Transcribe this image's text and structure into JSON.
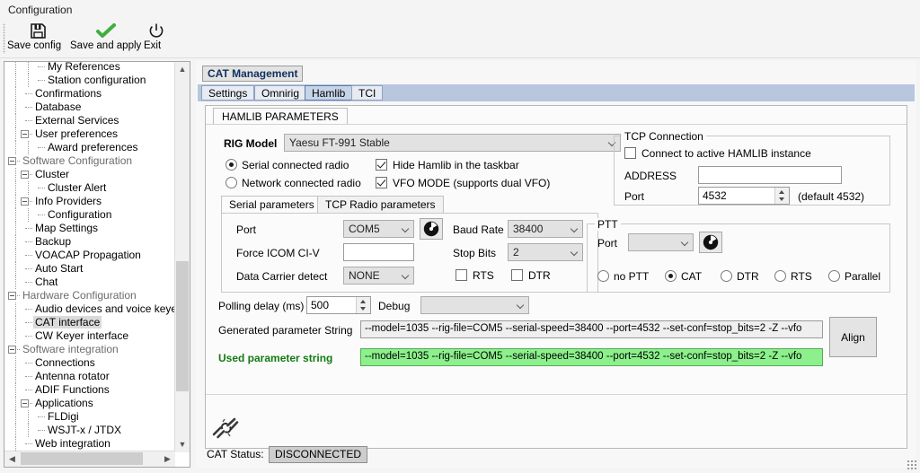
{
  "window": {
    "title": "Configuration"
  },
  "toolbar": {
    "buttons": [
      {
        "label": "Save config",
        "icon": "floppy-disk-icon"
      },
      {
        "label": "Save and apply",
        "icon": "green-check-icon"
      },
      {
        "label": "Exit",
        "icon": "power-icon"
      }
    ]
  },
  "tree": {
    "items": [
      {
        "label": "My References",
        "indent": 3,
        "type": "leaf",
        "state": "normal"
      },
      {
        "label": "Station configuration",
        "indent": 3,
        "type": "last",
        "state": "normal"
      },
      {
        "label": "Confirmations",
        "indent": 2,
        "type": "leaf",
        "state": "normal"
      },
      {
        "label": "Database",
        "indent": 2,
        "type": "leaf",
        "state": "normal"
      },
      {
        "label": "External Services",
        "indent": 2,
        "type": "leaf",
        "state": "normal"
      },
      {
        "label": "User preferences",
        "indent": 2,
        "type": "parent",
        "state": "normal"
      },
      {
        "label": "Award preferences",
        "indent": 3,
        "type": "last",
        "state": "normal"
      },
      {
        "label": "Software Configuration",
        "indent": 1,
        "type": "parent",
        "state": "dim"
      },
      {
        "label": "Cluster",
        "indent": 2,
        "type": "parent",
        "state": "normal"
      },
      {
        "label": "Cluster Alert",
        "indent": 3,
        "type": "last",
        "state": "normal"
      },
      {
        "label": "Info Providers",
        "indent": 2,
        "type": "parent",
        "state": "normal"
      },
      {
        "label": "Configuration",
        "indent": 3,
        "type": "last",
        "state": "normal"
      },
      {
        "label": "Map Settings",
        "indent": 2,
        "type": "leaf",
        "state": "normal"
      },
      {
        "label": "Backup",
        "indent": 2,
        "type": "leaf",
        "state": "normal"
      },
      {
        "label": "VOACAP Propagation",
        "indent": 2,
        "type": "leaf",
        "state": "normal"
      },
      {
        "label": "Auto Start",
        "indent": 2,
        "type": "leaf",
        "state": "normal"
      },
      {
        "label": "Chat",
        "indent": 2,
        "type": "last",
        "state": "normal"
      },
      {
        "label": "Hardware Configuration",
        "indent": 1,
        "type": "parent",
        "state": "dim"
      },
      {
        "label": "Audio devices and voice keyer",
        "indent": 2,
        "type": "leaf",
        "state": "normal"
      },
      {
        "label": "CAT interface",
        "indent": 2,
        "type": "leaf",
        "state": "selected"
      },
      {
        "label": "CW Keyer interface",
        "indent": 2,
        "type": "last",
        "state": "normal"
      },
      {
        "label": "Software integration",
        "indent": 1,
        "type": "parent",
        "state": "dim"
      },
      {
        "label": "Connections",
        "indent": 2,
        "type": "leaf",
        "state": "normal"
      },
      {
        "label": "Antenna rotator",
        "indent": 2,
        "type": "leaf",
        "state": "normal"
      },
      {
        "label": "ADIF Functions",
        "indent": 2,
        "type": "leaf",
        "state": "normal"
      },
      {
        "label": "Applications",
        "indent": 2,
        "type": "parent",
        "state": "normal"
      },
      {
        "label": "FLDigi",
        "indent": 3,
        "type": "leaf",
        "state": "normal"
      },
      {
        "label": "WSJT-x / JTDX",
        "indent": 3,
        "type": "last",
        "state": "normal"
      },
      {
        "label": "Web integration",
        "indent": 2,
        "type": "last",
        "state": "normal"
      }
    ]
  },
  "panel": {
    "caption": "CAT Management",
    "tabs": [
      {
        "label": "Settings",
        "active": false
      },
      {
        "label": "Omnirig",
        "active": false
      },
      {
        "label": "Hamlib",
        "active": true
      },
      {
        "label": "TCI",
        "active": false
      }
    ],
    "page_tab": "HAMLIB PARAMETERS"
  },
  "hamlib": {
    "rig_model_label": "RIG Model",
    "rig_model_value": "Yaesu FT-991 Stable",
    "serial_radio_label": "Serial connected radio",
    "network_radio_label": "Network connected radio",
    "connection_mode": "serial",
    "hide_hamlib_label": "Hide Hamlib in the taskbar",
    "hide_hamlib_checked": true,
    "vfo_mode_label": "VFO MODE (supports dual VFO)",
    "vfo_mode_checked": true,
    "sub_tabs": [
      {
        "label": "Serial parameters",
        "active": true
      },
      {
        "label": "TCP Radio parameters",
        "active": false
      }
    ],
    "serial": {
      "port_label": "Port",
      "port_value": "COM5",
      "refresh_icon": "refresh-circle-icon",
      "baud_label": "Baud Rate",
      "baud_value": "38400",
      "force_icom_label": "Force ICOM CI-V",
      "force_icom_value": "",
      "stop_bits_label": "Stop Bits",
      "stop_bits_value": "2",
      "dcd_label": "Data Carrier detect",
      "dcd_value": "NONE",
      "rts_label": "RTS",
      "rts_checked": false,
      "dtr_label": "DTR",
      "dtr_checked": false
    },
    "tcp": {
      "group_label": "TCP Connection",
      "connect_active_label": "Connect to active HAMLIB instance",
      "connect_active_checked": false,
      "address_label": "ADDRESS",
      "address_value": "",
      "port_label": "Port",
      "port_value": "4532",
      "port_default_hint": "(default 4532)"
    },
    "ptt": {
      "group_label": "PTT",
      "port_label": "Port",
      "port_value": "",
      "refresh_icon": "refresh-circle-icon",
      "options": [
        {
          "label": "no PTT",
          "selected": false
        },
        {
          "label": "CAT",
          "selected": true
        },
        {
          "label": "DTR",
          "selected": false
        },
        {
          "label": "RTS",
          "selected": false
        },
        {
          "label": "Parallel",
          "selected": false
        }
      ]
    },
    "polling_label": "Polling delay (ms)",
    "polling_value": "500",
    "debug_label": "Debug",
    "debug_value": "",
    "generated_label": "Generated parameter String",
    "generated_value": "--model=1035 --rig-file=COM5 --serial-speed=38400 --port=4532 --set-conf=stop_bits=2 -Z --vfo",
    "used_label": "Used parameter string",
    "used_value": "--model=1035 --rig-file=COM5 --serial-speed=38400 --port=4532 --set-conf=stop_bits=2 -Z --vfo",
    "align_button": "Align",
    "used_color": "#8cf08c"
  },
  "status": {
    "icon": "broken-chain-icon",
    "label": "CAT Status:",
    "value": "DISCONNECTED"
  }
}
